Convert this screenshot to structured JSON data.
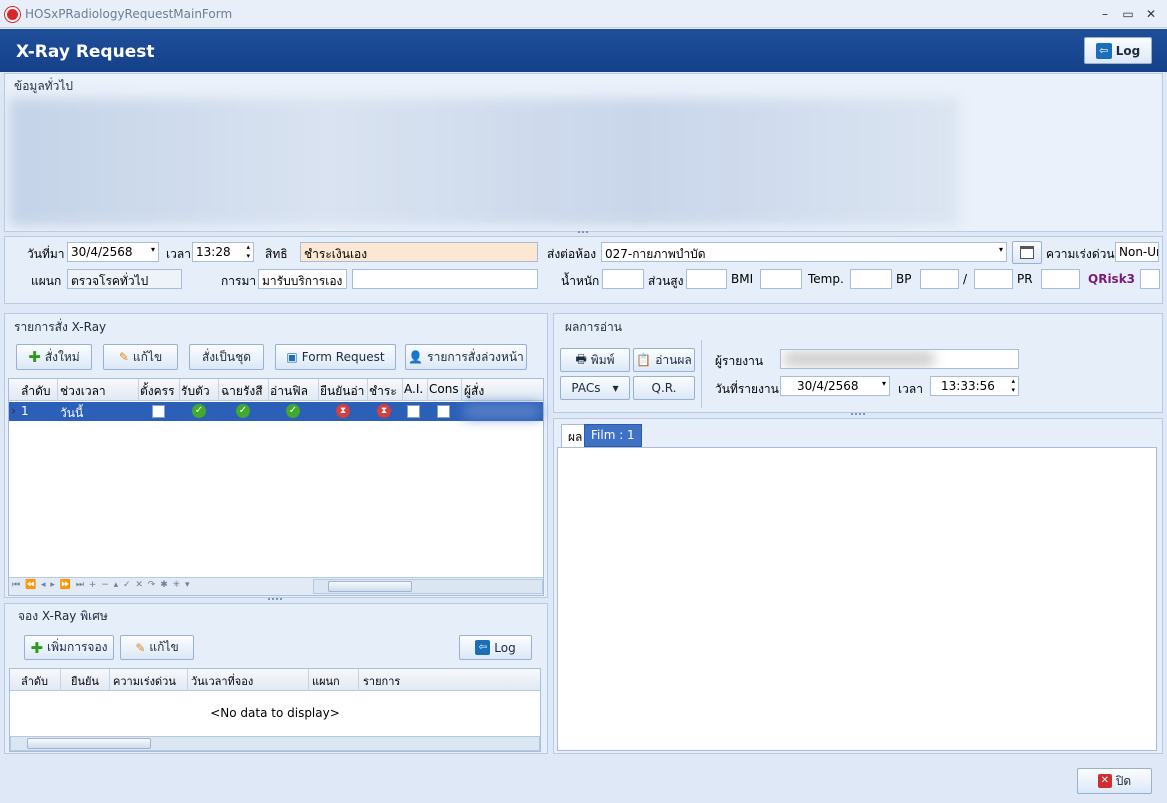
{
  "window": {
    "title": "HOSxPRadiologyRequestMainForm",
    "minimize": "–",
    "maximize": "▭",
    "close": "✕"
  },
  "header": {
    "title": "X-Ray Request",
    "log_label": "Log"
  },
  "general_section": {
    "label": "ข้อมูลทั่วไป"
  },
  "visit": {
    "date_label": "วันที่มา",
    "date_value": "30/4/2568",
    "time_label": "เวลา",
    "time_value": "13:28",
    "right_label": "สิทธิ",
    "right_value": "ชำระเงินเอง",
    "send_room_label": "ส่งต่อห้อง",
    "send_room_value": "027-กายภาพบำบัด",
    "urgency_label": "ความเร่งด่วน",
    "urgency_value": "Non-Ur",
    "dept_label": "แผนก",
    "dept_value": "ตรวจโรคทั่วไป",
    "arrival_label": "การมา",
    "arrival_value": "มารับบริการเอง",
    "weight_label": "น้ำหนัก",
    "height_label": "ส่วนสูง",
    "bmi_label": "BMI",
    "temp_label": "Temp.",
    "bp_label": "BP",
    "bp_sep": "/",
    "pr_label": "PR",
    "qrisk_label": "QRisk3"
  },
  "xray_orders": {
    "title": "รายการสั่ง X-Ray",
    "buttons": {
      "new": "สั่งใหม่",
      "edit": "แก้ไข",
      "set": "สั่งเป็นชุด",
      "form": "Form Request",
      "advance": "รายการสั่งล่วงหน้า"
    },
    "columns": [
      "ลำดับ",
      "ช่วงเวลา",
      "ตั้งครร",
      "รับตัว",
      "ฉายรังสี",
      "อ่านฟิล",
      "ยืนยันอ่า",
      "ชำระ",
      "A.I.",
      "Cons",
      "ผู้สั่ง"
    ],
    "rows": [
      {
        "no": "1",
        "period": "วันนี้"
      }
    ]
  },
  "booking": {
    "title": "จอง X-Ray พิเศษ",
    "buttons": {
      "add": "เพิ่มการจอง",
      "edit": "แก้ไข",
      "log": "Log"
    },
    "columns": [
      "ลำดับ",
      "ยืนยัน",
      "ความเร่งด่วน",
      "วันเวลาที่จอง",
      "แผนก",
      "รายการ"
    ],
    "empty": "<No data to display>"
  },
  "results": {
    "title": "ผลการอ่าน",
    "buttons": {
      "print": "พิมพ์",
      "read": "อ่านผล",
      "pacs": "PACs",
      "qr": "Q.R."
    },
    "reporter_label": "ผู้รายงาน",
    "report_date_label": "วันที่รายงาน",
    "report_date_value": "30/4/2568",
    "time_label": "เวลา",
    "time_value": "13:33:56",
    "tabs": [
      "ผล",
      "Film : 1"
    ]
  },
  "footer": {
    "close_label": "ปิด"
  },
  "nav_glyphs": "⏮ ⏪ ◂ ▸ ⏩ ⏭ + − ▴ ✓ ✕ ↷ ✱ ✳ ▾",
  "colors": {
    "header": "#1f4f9a",
    "selected_row": "#2b5fb8",
    "accent_green": "#42a92f",
    "accent_red": "#d24040",
    "qrisk": "#7b1a7b"
  }
}
